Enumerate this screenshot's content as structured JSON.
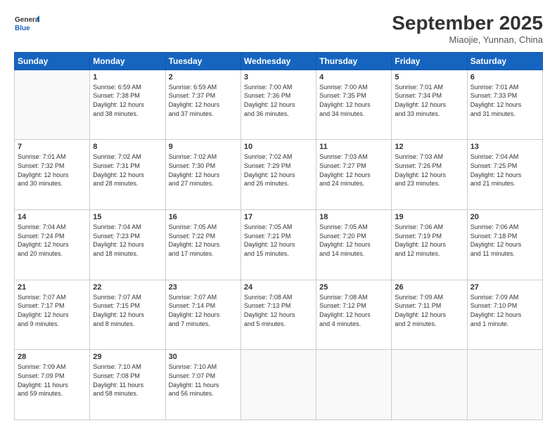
{
  "header": {
    "logo_line1": "General",
    "logo_line2": "Blue",
    "month": "September 2025",
    "location": "Miaojie, Yunnan, China"
  },
  "weekdays": [
    "Sunday",
    "Monday",
    "Tuesday",
    "Wednesday",
    "Thursday",
    "Friday",
    "Saturday"
  ],
  "weeks": [
    [
      {
        "day": "",
        "info": ""
      },
      {
        "day": "1",
        "info": "Sunrise: 6:59 AM\nSunset: 7:38 PM\nDaylight: 12 hours\nand 38 minutes."
      },
      {
        "day": "2",
        "info": "Sunrise: 6:59 AM\nSunset: 7:37 PM\nDaylight: 12 hours\nand 37 minutes."
      },
      {
        "day": "3",
        "info": "Sunrise: 7:00 AM\nSunset: 7:36 PM\nDaylight: 12 hours\nand 36 minutes."
      },
      {
        "day": "4",
        "info": "Sunrise: 7:00 AM\nSunset: 7:35 PM\nDaylight: 12 hours\nand 34 minutes."
      },
      {
        "day": "5",
        "info": "Sunrise: 7:01 AM\nSunset: 7:34 PM\nDaylight: 12 hours\nand 33 minutes."
      },
      {
        "day": "6",
        "info": "Sunrise: 7:01 AM\nSunset: 7:33 PM\nDaylight: 12 hours\nand 31 minutes."
      }
    ],
    [
      {
        "day": "7",
        "info": "Sunrise: 7:01 AM\nSunset: 7:32 PM\nDaylight: 12 hours\nand 30 minutes."
      },
      {
        "day": "8",
        "info": "Sunrise: 7:02 AM\nSunset: 7:31 PM\nDaylight: 12 hours\nand 28 minutes."
      },
      {
        "day": "9",
        "info": "Sunrise: 7:02 AM\nSunset: 7:30 PM\nDaylight: 12 hours\nand 27 minutes."
      },
      {
        "day": "10",
        "info": "Sunrise: 7:02 AM\nSunset: 7:29 PM\nDaylight: 12 hours\nand 26 minutes."
      },
      {
        "day": "11",
        "info": "Sunrise: 7:03 AM\nSunset: 7:27 PM\nDaylight: 12 hours\nand 24 minutes."
      },
      {
        "day": "12",
        "info": "Sunrise: 7:03 AM\nSunset: 7:26 PM\nDaylight: 12 hours\nand 23 minutes."
      },
      {
        "day": "13",
        "info": "Sunrise: 7:04 AM\nSunset: 7:25 PM\nDaylight: 12 hours\nand 21 minutes."
      }
    ],
    [
      {
        "day": "14",
        "info": "Sunrise: 7:04 AM\nSunset: 7:24 PM\nDaylight: 12 hours\nand 20 minutes."
      },
      {
        "day": "15",
        "info": "Sunrise: 7:04 AM\nSunset: 7:23 PM\nDaylight: 12 hours\nand 18 minutes."
      },
      {
        "day": "16",
        "info": "Sunrise: 7:05 AM\nSunset: 7:22 PM\nDaylight: 12 hours\nand 17 minutes."
      },
      {
        "day": "17",
        "info": "Sunrise: 7:05 AM\nSunset: 7:21 PM\nDaylight: 12 hours\nand 15 minutes."
      },
      {
        "day": "18",
        "info": "Sunrise: 7:05 AM\nSunset: 7:20 PM\nDaylight: 12 hours\nand 14 minutes."
      },
      {
        "day": "19",
        "info": "Sunrise: 7:06 AM\nSunset: 7:19 PM\nDaylight: 12 hours\nand 12 minutes."
      },
      {
        "day": "20",
        "info": "Sunrise: 7:06 AM\nSunset: 7:18 PM\nDaylight: 12 hours\nand 11 minutes."
      }
    ],
    [
      {
        "day": "21",
        "info": "Sunrise: 7:07 AM\nSunset: 7:17 PM\nDaylight: 12 hours\nand 9 minutes."
      },
      {
        "day": "22",
        "info": "Sunrise: 7:07 AM\nSunset: 7:15 PM\nDaylight: 12 hours\nand 8 minutes."
      },
      {
        "day": "23",
        "info": "Sunrise: 7:07 AM\nSunset: 7:14 PM\nDaylight: 12 hours\nand 7 minutes."
      },
      {
        "day": "24",
        "info": "Sunrise: 7:08 AM\nSunset: 7:13 PM\nDaylight: 12 hours\nand 5 minutes."
      },
      {
        "day": "25",
        "info": "Sunrise: 7:08 AM\nSunset: 7:12 PM\nDaylight: 12 hours\nand 4 minutes."
      },
      {
        "day": "26",
        "info": "Sunrise: 7:09 AM\nSunset: 7:11 PM\nDaylight: 12 hours\nand 2 minutes."
      },
      {
        "day": "27",
        "info": "Sunrise: 7:09 AM\nSunset: 7:10 PM\nDaylight: 12 hours\nand 1 minute."
      }
    ],
    [
      {
        "day": "28",
        "info": "Sunrise: 7:09 AM\nSunset: 7:09 PM\nDaylight: 11 hours\nand 59 minutes."
      },
      {
        "day": "29",
        "info": "Sunrise: 7:10 AM\nSunset: 7:08 PM\nDaylight: 11 hours\nand 58 minutes."
      },
      {
        "day": "30",
        "info": "Sunrise: 7:10 AM\nSunset: 7:07 PM\nDaylight: 11 hours\nand 56 minutes."
      },
      {
        "day": "",
        "info": ""
      },
      {
        "day": "",
        "info": ""
      },
      {
        "day": "",
        "info": ""
      },
      {
        "day": "",
        "info": ""
      }
    ]
  ]
}
